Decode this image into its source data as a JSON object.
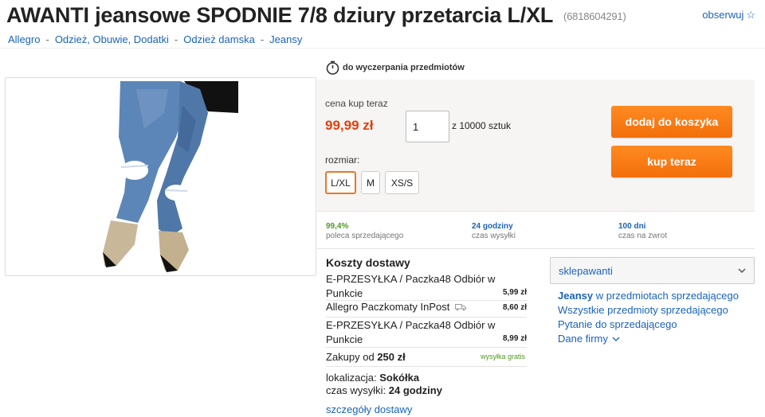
{
  "title": "AWANTI jeansowe SPODNIE 7/8 dziury przetarcia L/XL",
  "offer_id": "(6818604291)",
  "observe_label": "obserwuj",
  "breadcrumb": [
    "Allegro",
    "Odzież, Obuwie, Dodatki",
    "Odzież damska",
    "Jeansy"
  ],
  "timer_label": "do wyczerpania przedmiotów",
  "buy": {
    "price_label": "cena kup teraz",
    "price": "99,99 zł",
    "quantity": "1",
    "quantity_of": "z 10000 sztuk",
    "size_label": "rozmiar:",
    "sizes": [
      "L/XL",
      "M",
      "XS/S"
    ],
    "selected_size": "L/XL",
    "add_to_cart": "dodaj do koszyka",
    "buy_now": "kup teraz"
  },
  "stats": [
    {
      "value": "99,4%",
      "desc": "poleca sprzedającego"
    },
    {
      "value": "24 godziny",
      "desc": "czas wysyłki"
    },
    {
      "value": "100 dni",
      "desc": "czas na zwrot"
    }
  ],
  "shipping": {
    "title": "Koszty dostawy",
    "options": [
      {
        "name": "E-PRZESYŁKA / Paczka48 Odbiór w Punkcie",
        "price": "5,99 zł"
      },
      {
        "name": "Allegro Paczkomaty InPost",
        "price": "8,60 zł"
      },
      {
        "name": "E-PRZESYŁKA / Paczka48 Odbiór w Punkcie",
        "price": "8,99 zł"
      }
    ],
    "free_prefix": "Zakupy od",
    "free_amount": "250 zł",
    "free_label": "wysyłka gratis",
    "location_label": "lokalizacja:",
    "location": "Sokółka",
    "ship_time_label": "czas wysyłki:",
    "ship_time": "24 godziny",
    "details_link": "szczegóły dostawy"
  },
  "seller": {
    "name": "sklepawanti",
    "link_category_bold": "Jeansy",
    "link_category_rest": "w przedmiotach sprzedającego",
    "link_all": "Wszystkie przedmioty sprzedającego",
    "link_question": "Pytanie do sprzedającego",
    "link_company": "Dane firmy"
  },
  "colors": {
    "accent_orange": "#f26f0a",
    "price_red": "#e4400b",
    "link_blue": "#1a63b8",
    "positive_green": "#4f9a20",
    "panel_bg": "#f6f5f3"
  }
}
